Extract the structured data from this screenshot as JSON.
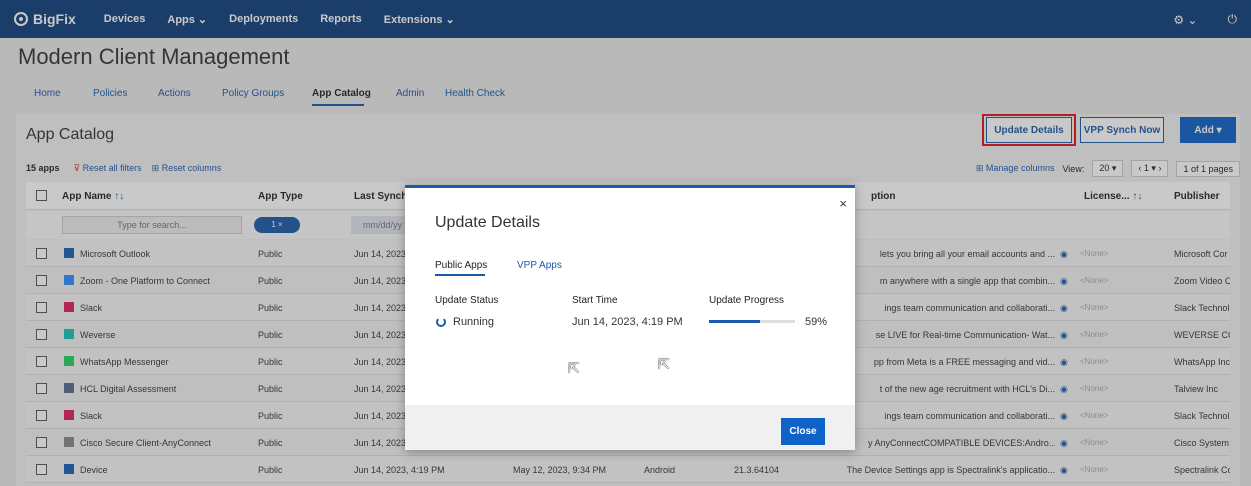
{
  "topnav": {
    "brand": "BigFix",
    "items": [
      "Devices",
      "Apps ⌄",
      "Deployments",
      "Reports",
      "Extensions ⌄"
    ],
    "settings_icon": "gear-icon",
    "power_icon": "power-icon"
  },
  "app_title": "Modern Client Management",
  "subnav": {
    "items": [
      "Home",
      "Policies",
      "Actions",
      "Policy Groups",
      "App Catalog",
      "Admin",
      "Health Check"
    ],
    "active": "App Catalog"
  },
  "catalog": {
    "title": "App Catalog",
    "buttons": {
      "update_details": "Update Details",
      "vpp_sync": "VPP Synch Now",
      "add": "Add ▾"
    },
    "count": "15 apps",
    "reset_filters": "Reset all filters",
    "reset_columns": "Reset columns",
    "manage_columns": "Manage columns",
    "view_label": "View:",
    "view_value": "20",
    "page_value": "1",
    "pages_text": "1 of 1 pages",
    "columns": [
      "App Name",
      "App Type",
      "Last Synch",
      "ption",
      "License...",
      "Publisher"
    ],
    "search_placeholder": "Type for search...",
    "chip_text": "1  ×",
    "date_placeholder": "mm/dd/yy",
    "rows": [
      {
        "name": "Microsoft Outlook",
        "type": "Public",
        "synch": "Jun 14, 2023",
        "desc": "lets you bring all your email accounts and ...",
        "license": "<None>",
        "publisher": "Microsoft Cor",
        "icon_color": "#1b5fb6"
      },
      {
        "name": "Zoom - One Platform to Connect",
        "type": "Public",
        "synch": "Jun 14, 2023",
        "desc": "m anywhere with a single app that combin...",
        "license": "<None>",
        "publisher": "Zoom Video C",
        "icon_color": "#2d8cff"
      },
      {
        "name": "Slack",
        "type": "Public",
        "synch": "Jun 14, 2023",
        "desc": "ings team communication and collaborati...",
        "license": "<None>",
        "publisher": "Slack Technol",
        "icon_color": "#e01e5a"
      },
      {
        "name": "Weverse",
        "type": "Public",
        "synch": "Jun 14, 2023",
        "desc": "se LIVE for Real-time Communication- Wat...",
        "license": "<None>",
        "publisher": "WEVERSE COI",
        "icon_color": "#18c4b7"
      },
      {
        "name": "WhatsApp Messenger",
        "type": "Public",
        "synch": "Jun 14, 2023",
        "desc": "pp from Meta is a FREE messaging and vid...",
        "license": "<None>",
        "publisher": "WhatsApp Inc",
        "icon_color": "#25d366"
      },
      {
        "name": "HCL Digital Assessment",
        "type": "Public",
        "synch": "Jun 14, 2023",
        "desc": "t of the new age recruitment with HCL's Di...",
        "license": "<None>",
        "publisher": "Talview Inc",
        "icon_color": "#5a6b8c"
      },
      {
        "name": "Slack",
        "type": "Public",
        "synch": "Jun 14, 2023",
        "desc": "ings team communication and collaborati...",
        "license": "<None>",
        "publisher": "Slack Technol",
        "icon_color": "#e01e5a"
      },
      {
        "name": "Cisco Secure Client-AnyConnect",
        "type": "Public",
        "synch": "Jun 14, 2023",
        "desc": "y AnyConnectCOMPATIBLE DEVICES:Andro...",
        "license": "<None>",
        "publisher": "Cisco System",
        "icon_color": "#888888"
      },
      {
        "name": "Device",
        "type": "Public",
        "synch": "Jun 14, 2023, 4:19 PM",
        "extra_date": "May 12, 2023, 9:34 PM",
        "platform": "Android",
        "version": "21.3.64104",
        "desc": "The Device Settings app is Spectralink's applicatio...",
        "license": "<None>",
        "publisher": "Spectralink Co",
        "icon_color": "#1b5fb6"
      }
    ]
  },
  "modal": {
    "title": "Update Details",
    "tabs": [
      "Public Apps",
      "VPP Apps"
    ],
    "headers": [
      "Update Status",
      "Start Time",
      "Update Progress"
    ],
    "status": "Running",
    "start_time": "Jun 14, 2023, 4:19 PM",
    "progress_percent": 59,
    "progress_text": "59%",
    "close_label": "Close",
    "close_icon": "×"
  }
}
